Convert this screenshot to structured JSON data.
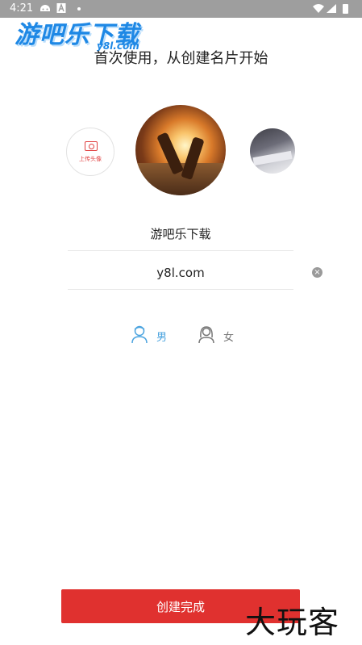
{
  "status_bar": {
    "time": "4:21"
  },
  "watermark_top": {
    "title": "游吧乐下载",
    "subtitle": "y8l.com"
  },
  "heading": "首次使用，从创建名片开始",
  "upload": {
    "label": "上传头像"
  },
  "name_field": {
    "value": "游吧乐下载"
  },
  "secondary_field": {
    "value": "y8l.com"
  },
  "gender": {
    "male_label": "男",
    "female_label": "女",
    "selected": "male"
  },
  "submit_button": {
    "label": "创建完成"
  },
  "watermark_bottom": "大玩客",
  "colors": {
    "accent_red": "#e0312f",
    "male_blue": "#4aa3df",
    "status_bar": "#9e9e9e"
  },
  "icons": [
    "android-icon",
    "a-icon",
    "wifi-icon",
    "signal-icon",
    "battery-icon",
    "camera-icon",
    "male-icon",
    "female-icon",
    "clear-icon"
  ]
}
